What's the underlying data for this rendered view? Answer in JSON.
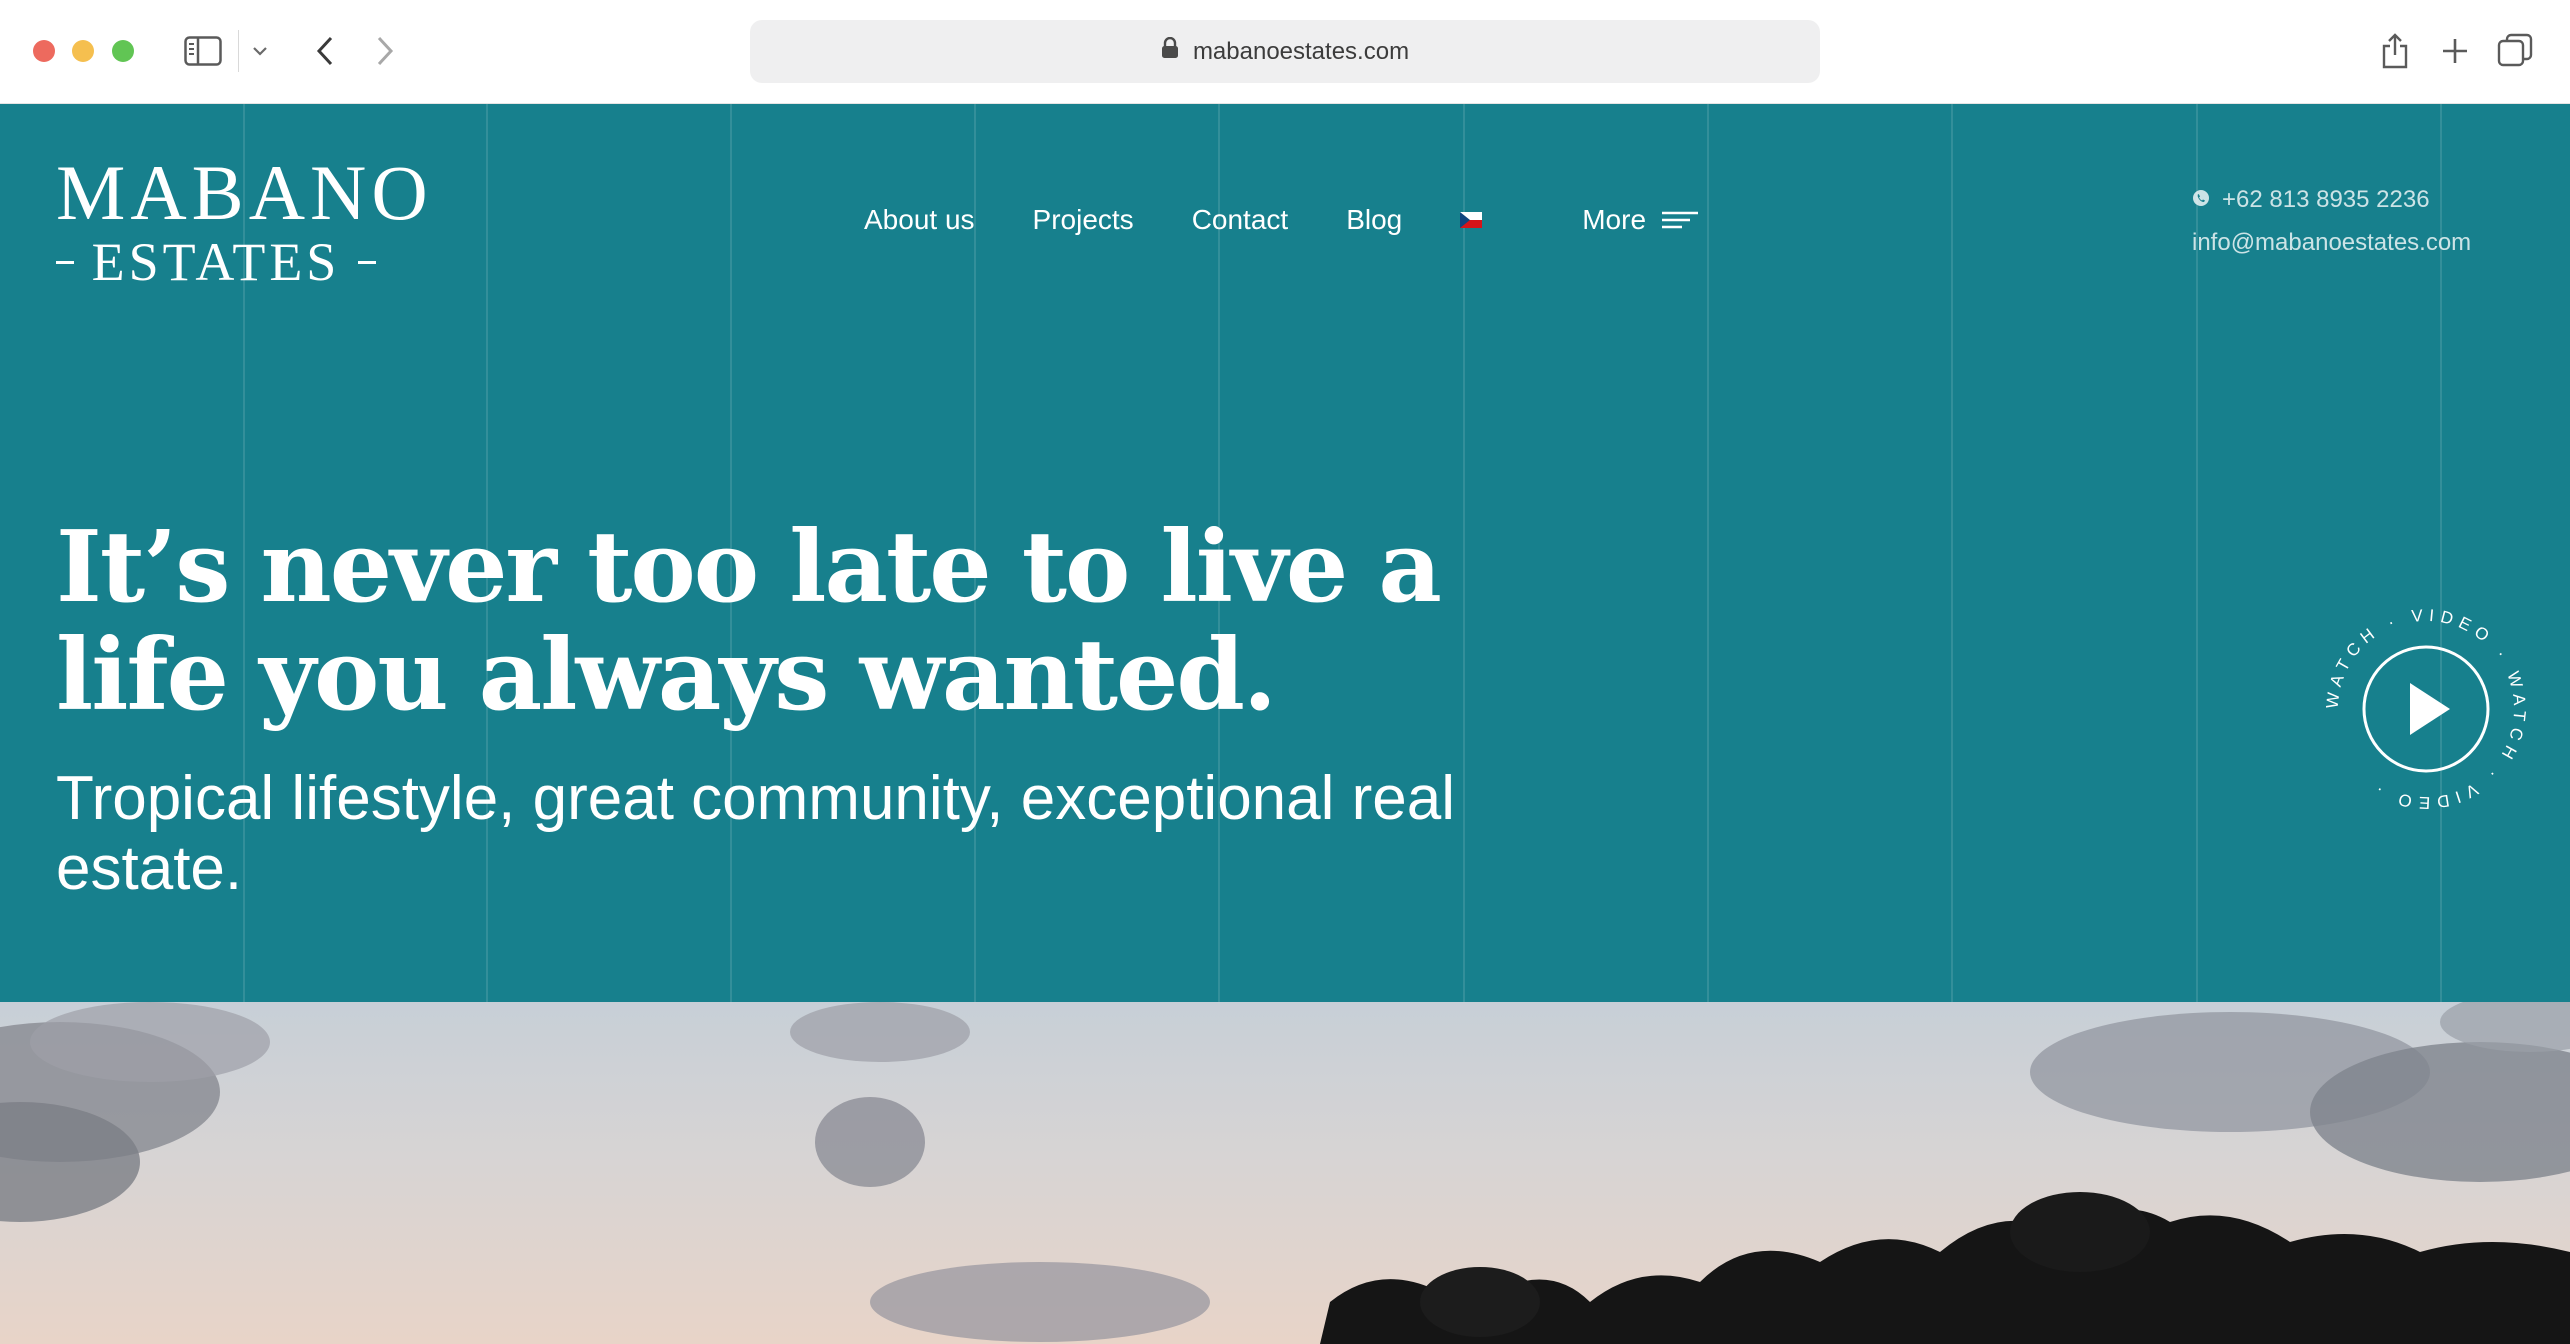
{
  "browser": {
    "url": "mabanoestates.com",
    "icons": [
      "sidebar-icon",
      "chevron-down-icon",
      "back-arrow-icon",
      "forward-arrow-icon",
      "lock-icon",
      "share-icon",
      "plus-icon",
      "tabs-icon"
    ]
  },
  "logo": {
    "top": "MABANO",
    "bottom": "ESTATES"
  },
  "nav": {
    "items": [
      "About us",
      "Projects",
      "Contact",
      "Blog"
    ],
    "more_label": "More"
  },
  "contact": {
    "phone": "+62 813 8935 2236",
    "email": "info@mabanoestates.com"
  },
  "hero": {
    "headline": "It’s never too late to live a life you always wanted.",
    "subheadline": "Tropical lifestyle, great community, exceptional real estate.",
    "watch_video_ring_text": "WATCH · VIDEO · WATCH · VIDEO ·"
  },
  "colors": {
    "hero_bg": "#17808d",
    "text": "#ffffff",
    "flag": [
      "#ffffff",
      "#d7141a",
      "#11457e"
    ]
  }
}
